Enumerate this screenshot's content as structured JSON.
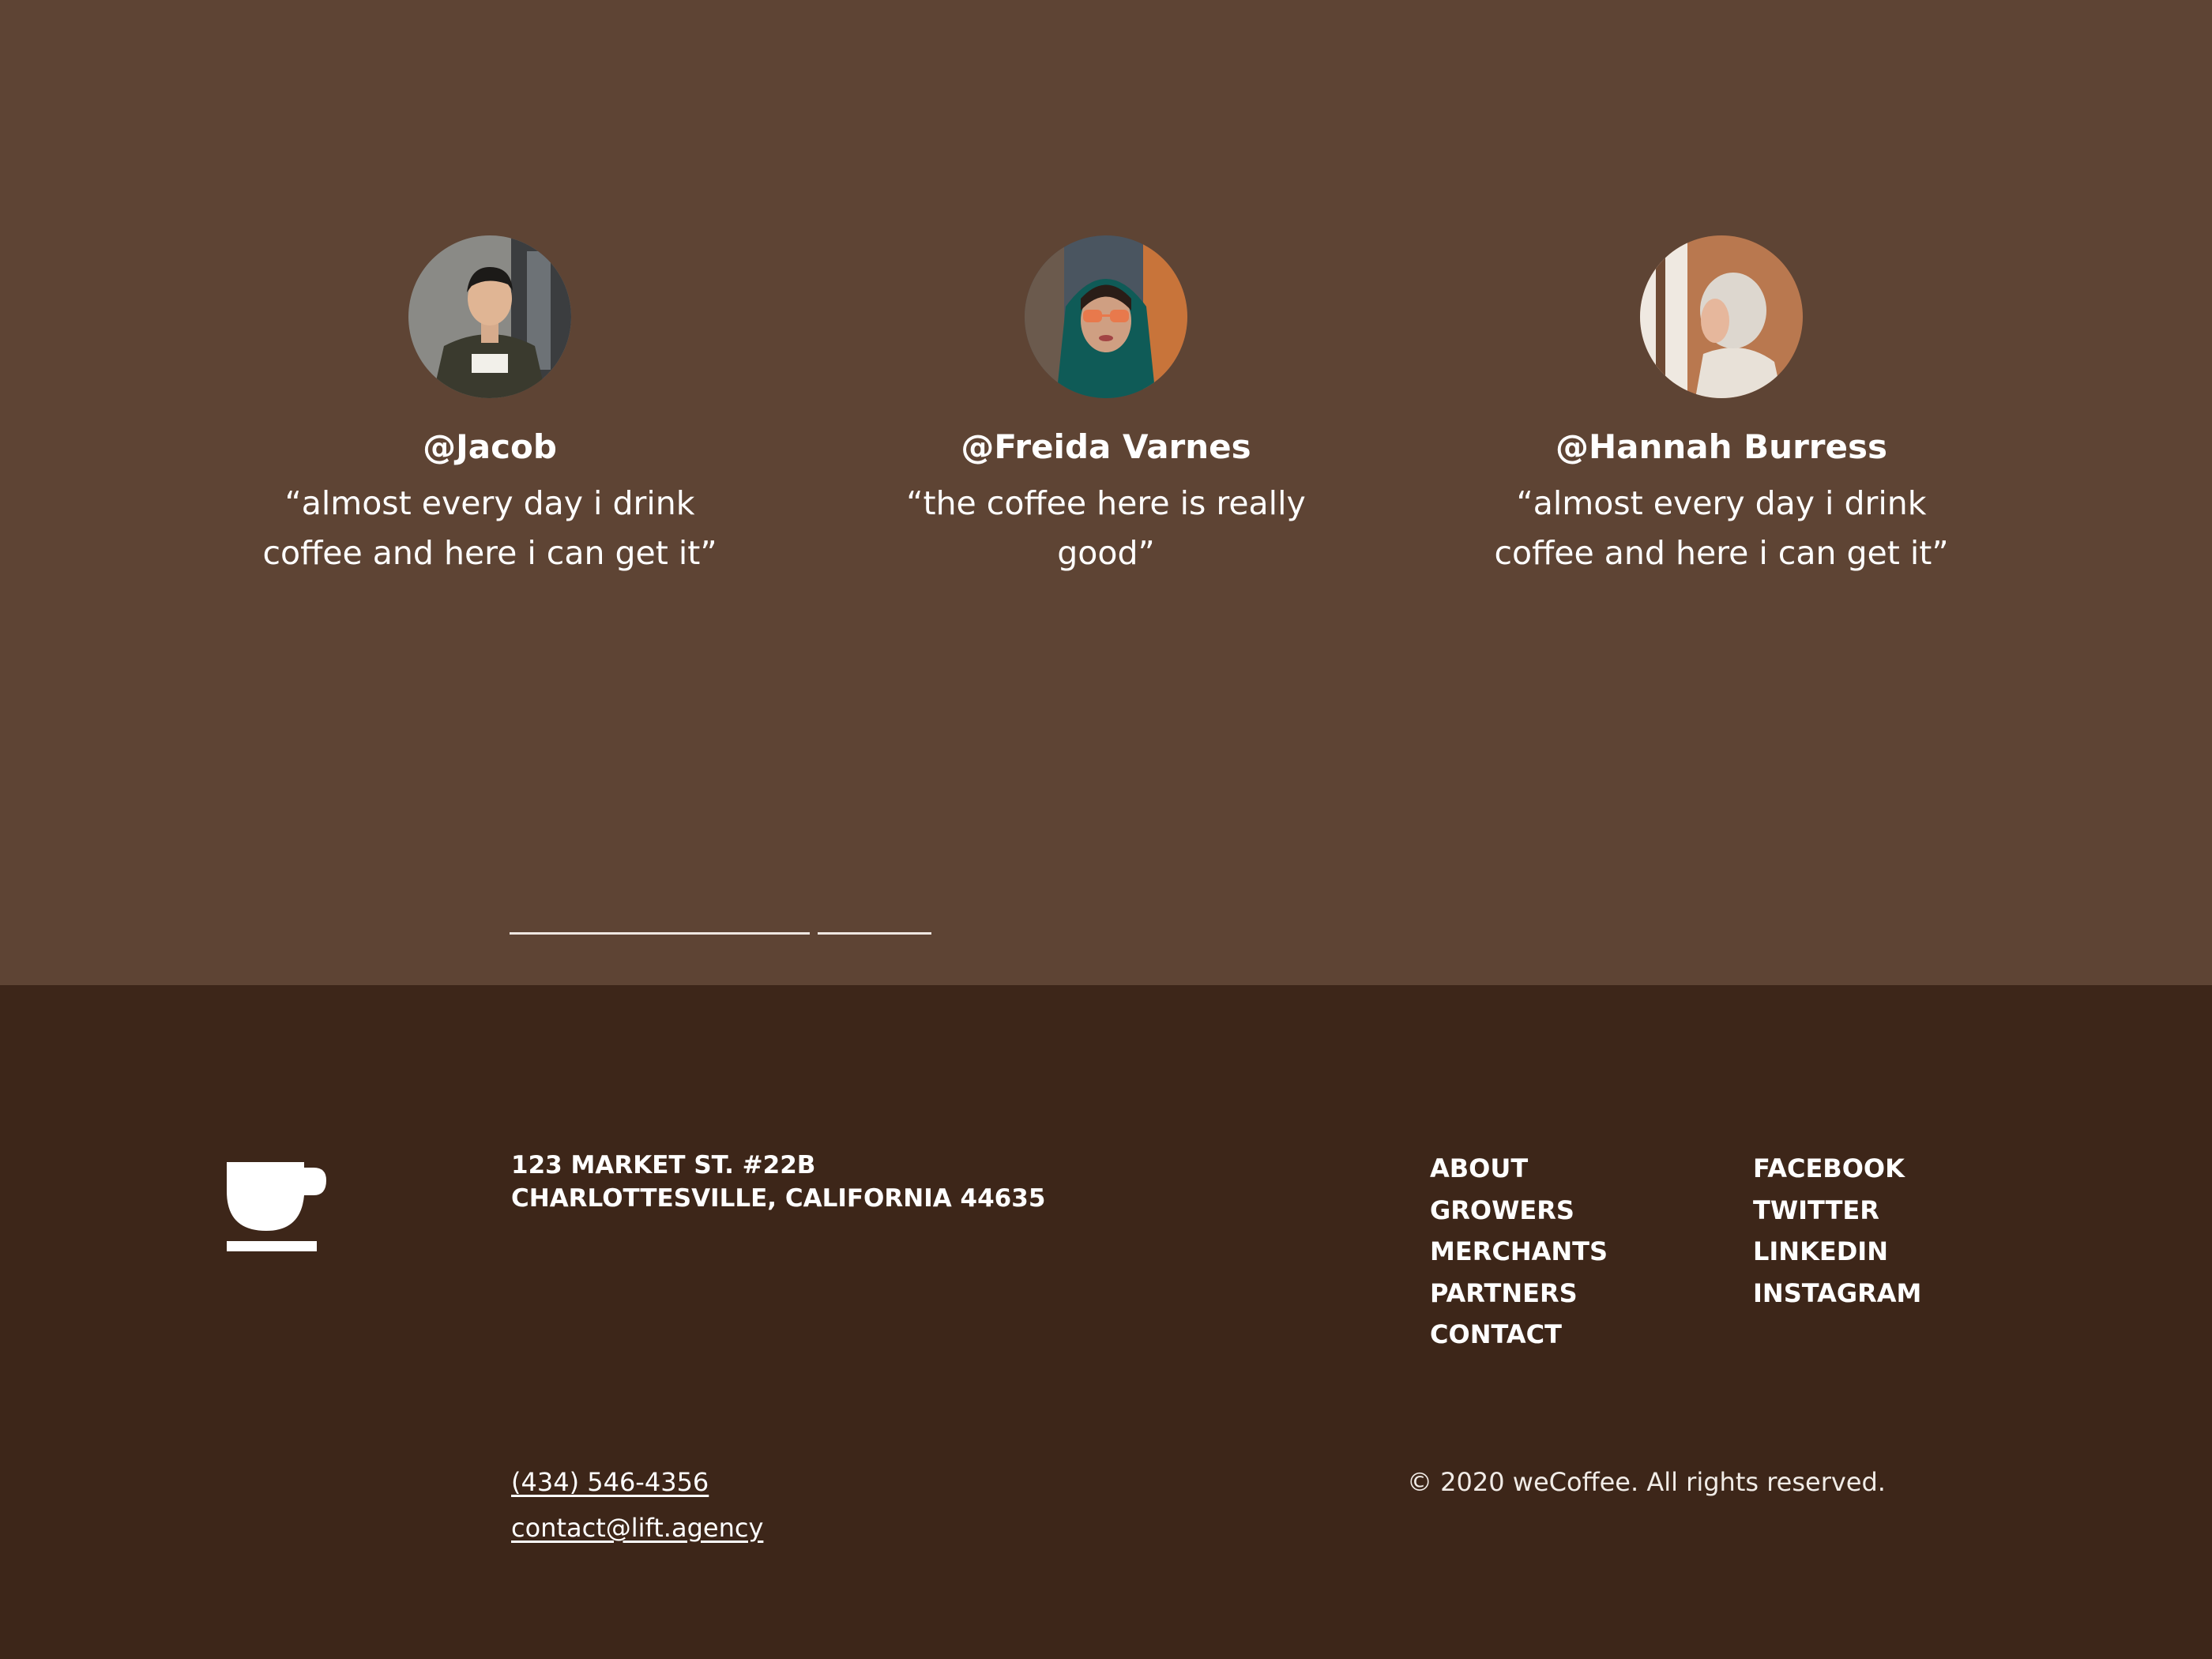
{
  "testimonials": [
    {
      "handle": "@Jacob",
      "quote": "“almost every day i drink coffee and here i can get it”"
    },
    {
      "handle": "@Freida Varnes",
      "quote": "“the coffee here is really good”"
    },
    {
      "handle": "@Hannah Burress",
      "quote": "“almost every day i drink coffee and here i can get it”"
    }
  ],
  "footer": {
    "logo_icon": "coffee-cup-icon",
    "address_line1": "123 MARKET ST. #22B",
    "address_line2": "CHARLOTTESVILLE, CALIFORNIA 44635",
    "nav_links": [
      "ABOUT",
      "GROWERS",
      "MERCHANTS",
      "PARTNERS",
      "CONTACT"
    ],
    "social_links": [
      "FACEBOOK",
      "TWITTER",
      "LINKEDIN",
      "INSTAGRAM"
    ],
    "phone": "(434) 546-4356",
    "email": "contact@lift.agency",
    "copyright": "© 2020 weCoffee. All rights reserved."
  },
  "colors": {
    "testimonial_bg": "#5e4434",
    "footer_bg": "#3d2619",
    "text": "#ffffff"
  }
}
